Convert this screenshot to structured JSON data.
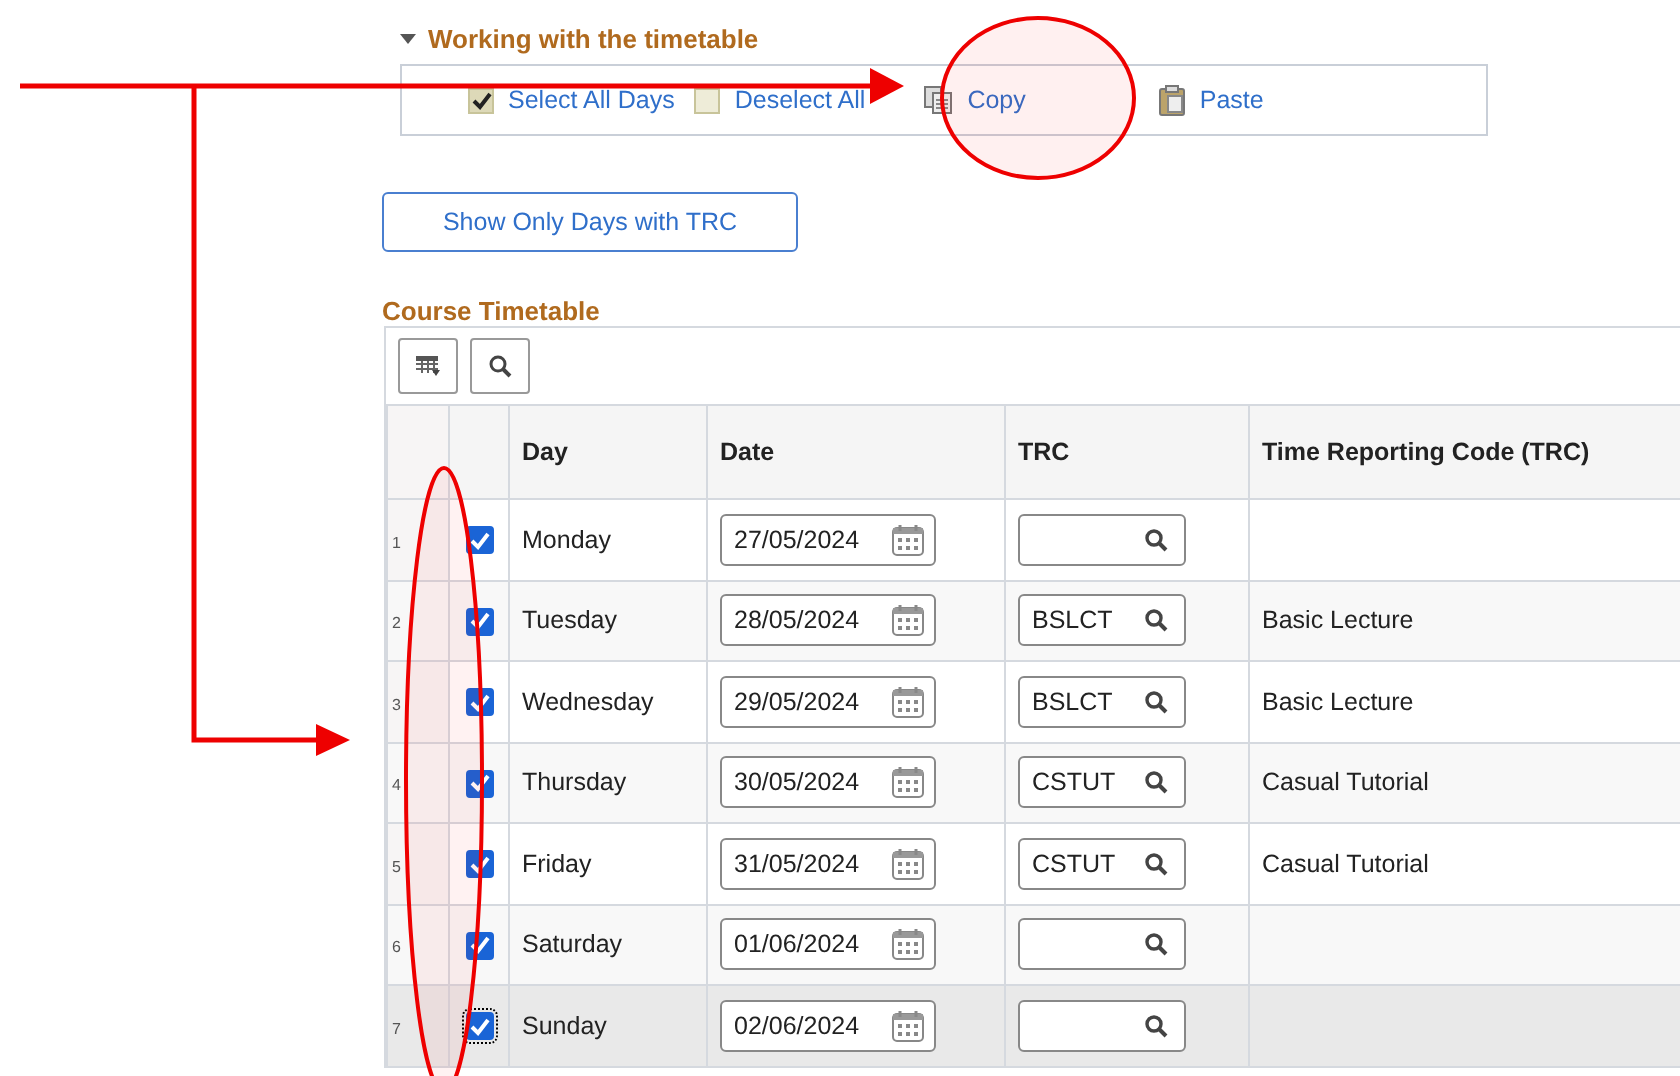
{
  "section": {
    "title": "Working with the timetable",
    "expanded": true,
    "actions": [
      {
        "kind": "checkbox",
        "label": "Select All Days",
        "checked": true
      },
      {
        "kind": "checkbox",
        "label": "Deselect All",
        "checked": false
      },
      {
        "kind": "copy",
        "label": "Copy"
      },
      {
        "kind": "paste",
        "label": "Paste"
      }
    ]
  },
  "filter_button": "Show Only Days with TRC",
  "grid": {
    "title": "Course Timetable",
    "columns": [
      "Day",
      "Date",
      "TRC",
      "Time Reporting Code (TRC)"
    ],
    "rows": [
      {
        "num": "1",
        "checked": true,
        "day": "Monday",
        "date": "27/05/2024",
        "selected": false
      },
      {
        "num": "2",
        "checked": true,
        "day": "Tuesday",
        "date": "28/05/2024",
        "trc": "BSLCT",
        "description": "Basic Lecture",
        "selected": false
      },
      {
        "num": "3",
        "checked": true,
        "day": "Wednesday",
        "date": "29/05/2024",
        "trc": "BSLCT",
        "description": "Basic Lecture",
        "selected": false
      },
      {
        "num": "4",
        "checked": true,
        "day": "Thursday",
        "date": "30/05/2024",
        "trc": "CSTUT",
        "description": "Casual Tutorial",
        "selected": false
      },
      {
        "num": "5",
        "checked": true,
        "day": "Friday",
        "date": "31/05/2024",
        "trc": "CSTUT",
        "description": "Casual Tutorial",
        "selected": false
      },
      {
        "num": "6",
        "checked": true,
        "day": "Saturday",
        "date": "01/06/2024",
        "selected": false
      },
      {
        "num": "7",
        "checked": true,
        "day": "Sunday",
        "date": "02/06/2024",
        "selected": true
      }
    ]
  }
}
